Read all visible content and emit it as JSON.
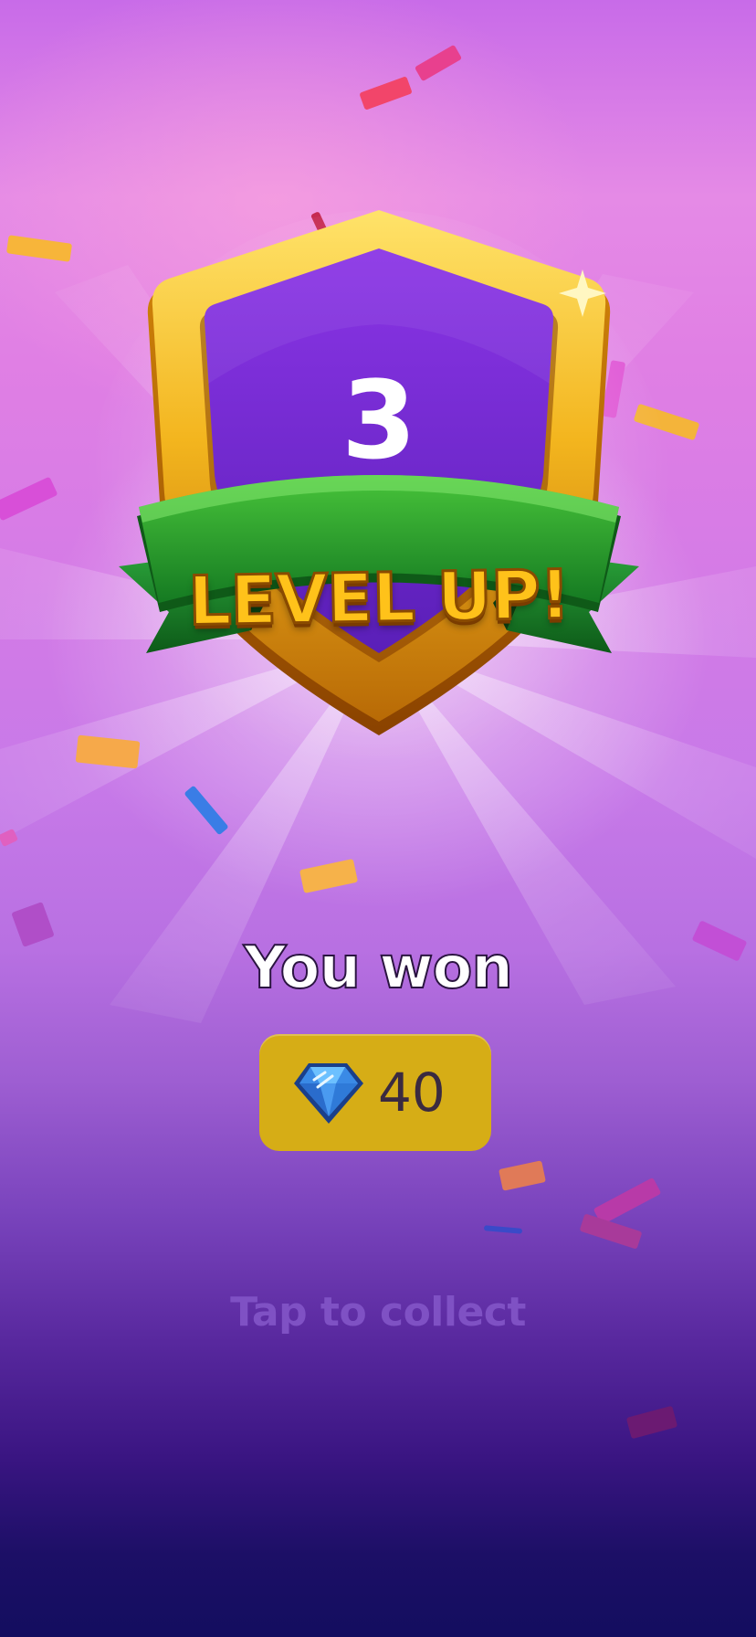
{
  "level_badge": {
    "level_number": "3",
    "banner_text": "LEVEL UP!"
  },
  "reward": {
    "heading": "You won",
    "amount": "40",
    "currency_icon": "gem-icon"
  },
  "collect_prompt": "Tap to collect",
  "colors": {
    "background_top": "#c86be8",
    "background_bottom": "#130d5f",
    "shield_purple": "#6a24c8",
    "shield_gold": "#f2b320",
    "ribbon_green": "#1f9a2a",
    "pill_gold": "#d6ad16",
    "collect_text": "#7f51c4"
  }
}
